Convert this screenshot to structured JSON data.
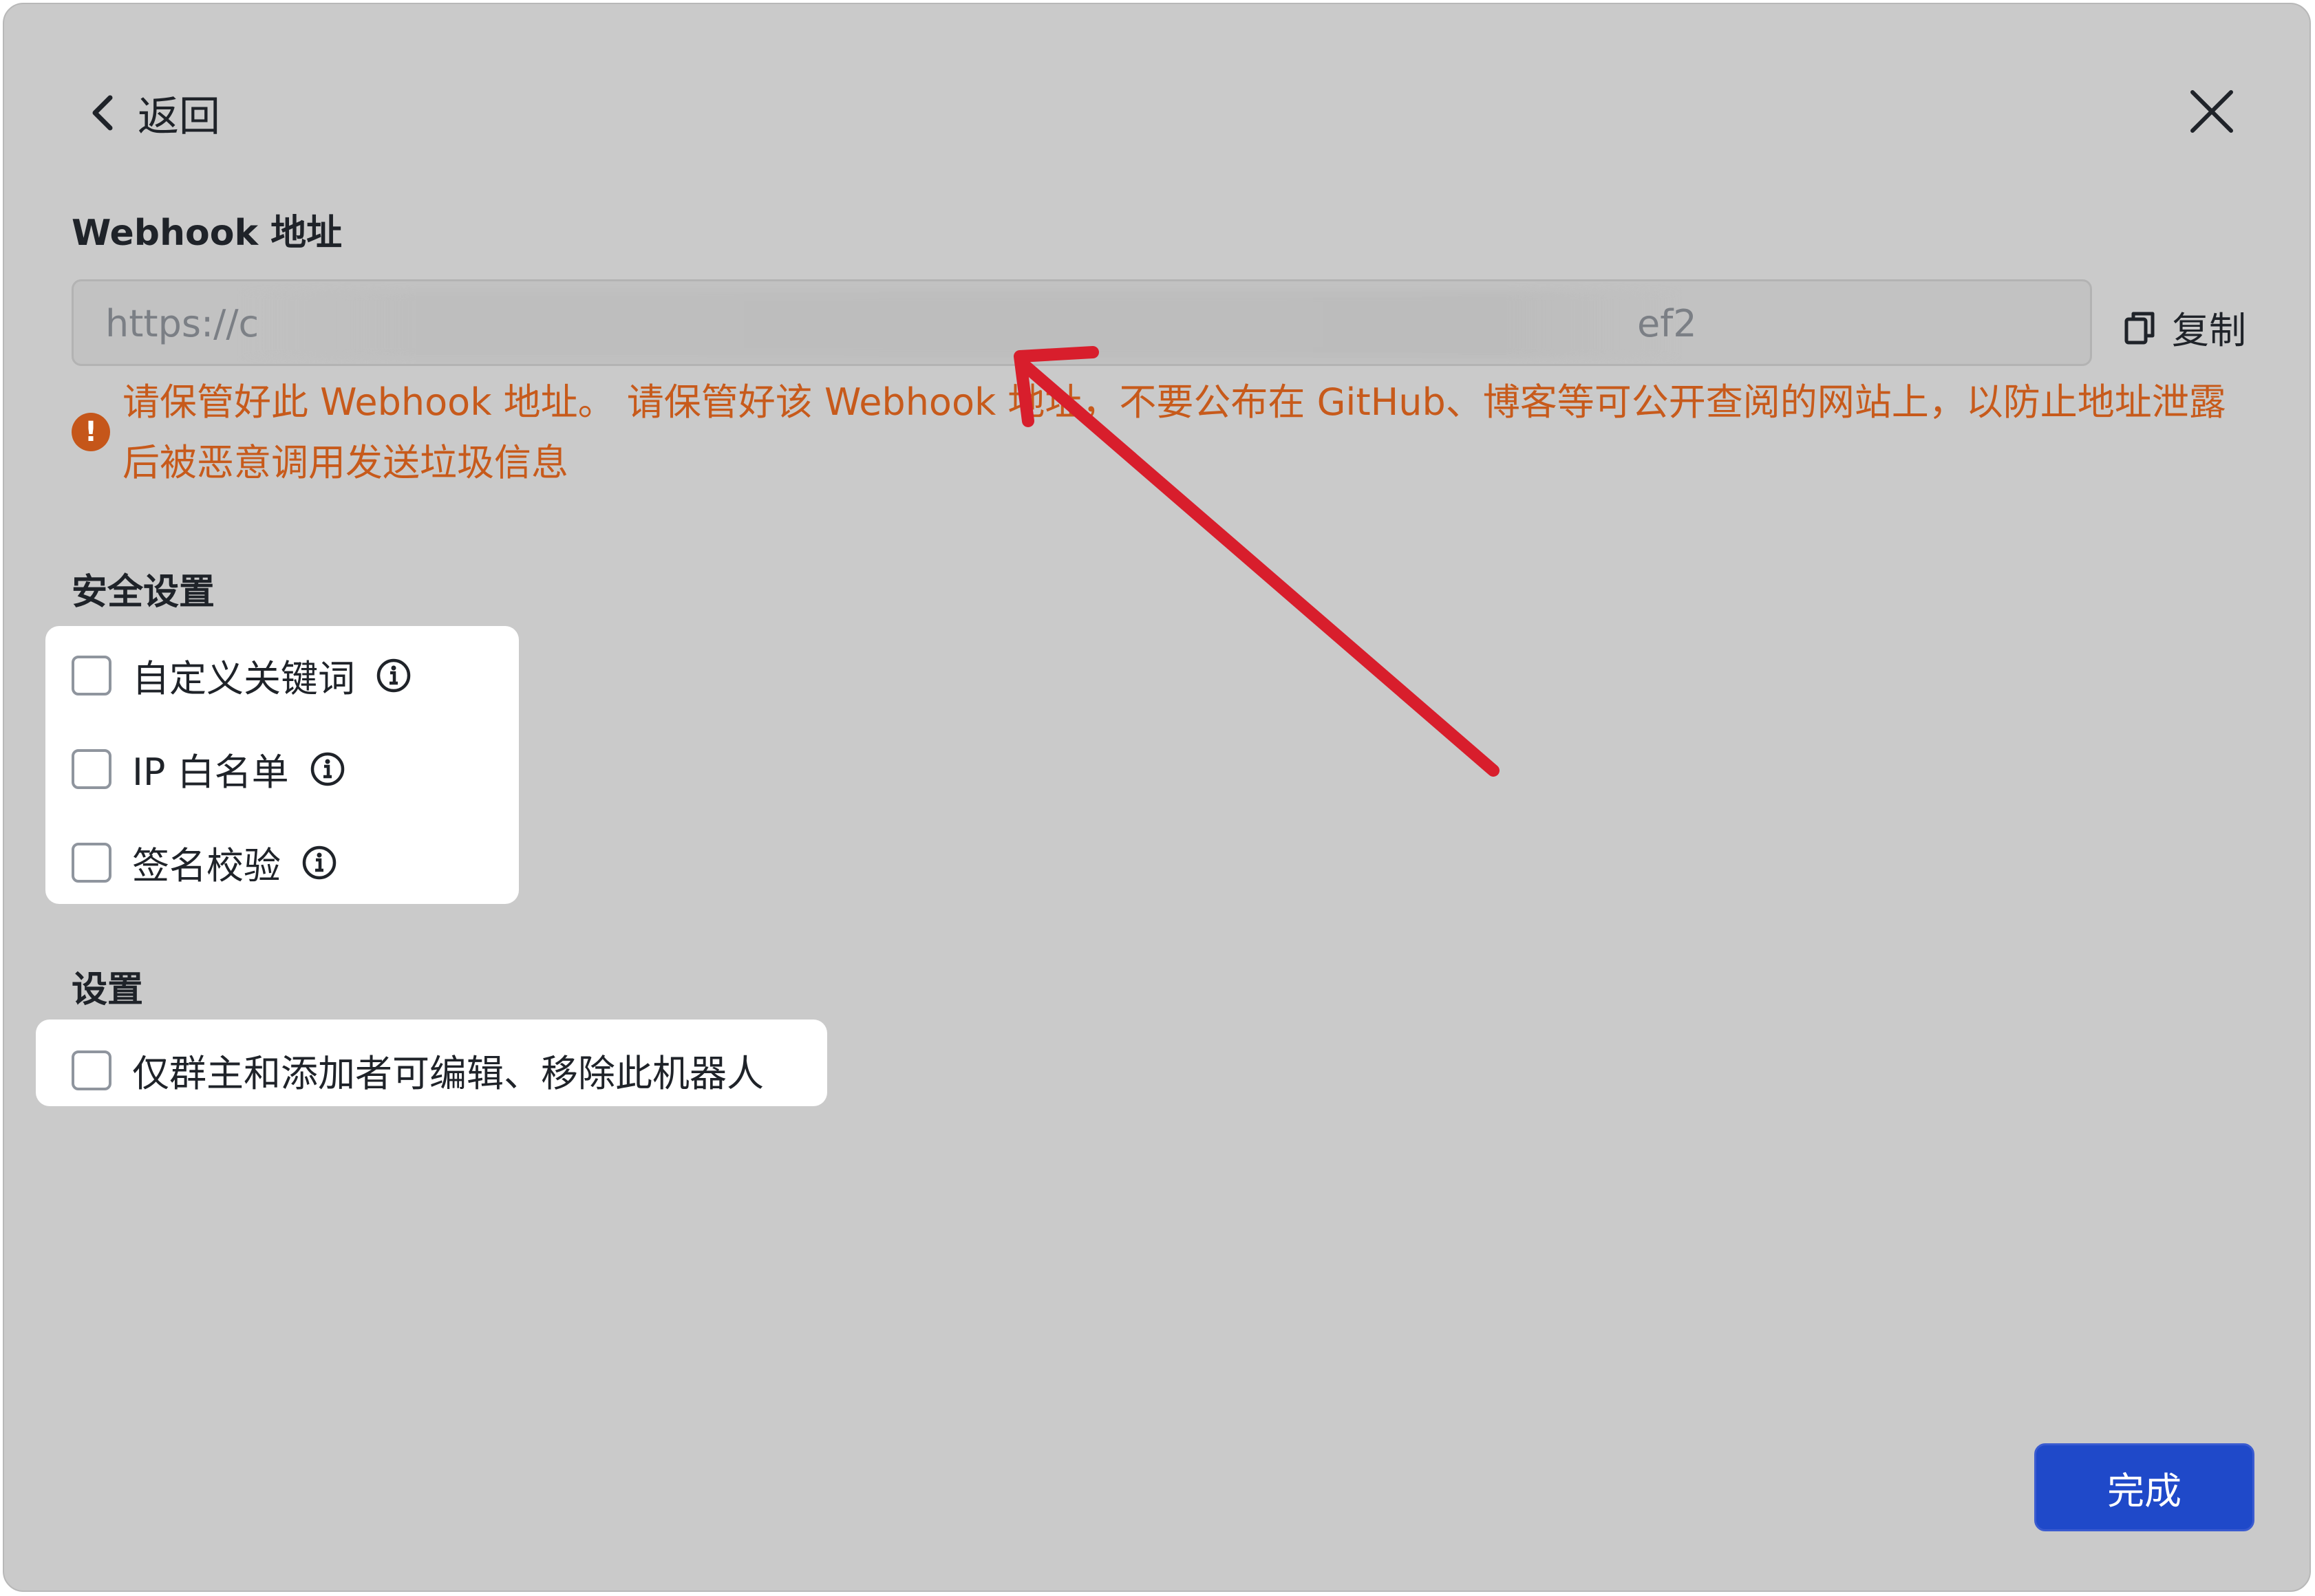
{
  "header": {
    "back_label": "返回"
  },
  "webhook": {
    "title": "Webhook 地址",
    "url_visible_start": "https://c",
    "url_visible_end": "ef2",
    "copy_label": "复制",
    "warning": "请保管好此 Webhook 地址。 请保管好该 Webhook 地址，不要公布在 GitHub、博客等可公开查阅的网站上，以防止地址泄露后被恶意调用发送垃圾信息"
  },
  "security": {
    "title": "安全设置",
    "options": [
      {
        "label": "自定义关键词",
        "checked": false
      },
      {
        "label": "IP 白名单",
        "checked": false
      },
      {
        "label": "签名校验",
        "checked": false
      }
    ]
  },
  "settings": {
    "title": "设置",
    "options": [
      {
        "label": "仅群主和添加者可编辑、移除此机器人",
        "checked": false
      }
    ]
  },
  "footer": {
    "done_label": "完成"
  },
  "colors": {
    "warning": "#c75a1b",
    "primary": "#1f49c9",
    "annotation_arrow": "#d81e2c"
  },
  "icons": {
    "back": "chevron-left-icon",
    "close": "close-icon",
    "copy": "copy-icon",
    "warning": "exclamation-circle-icon",
    "info": "info-icon"
  }
}
